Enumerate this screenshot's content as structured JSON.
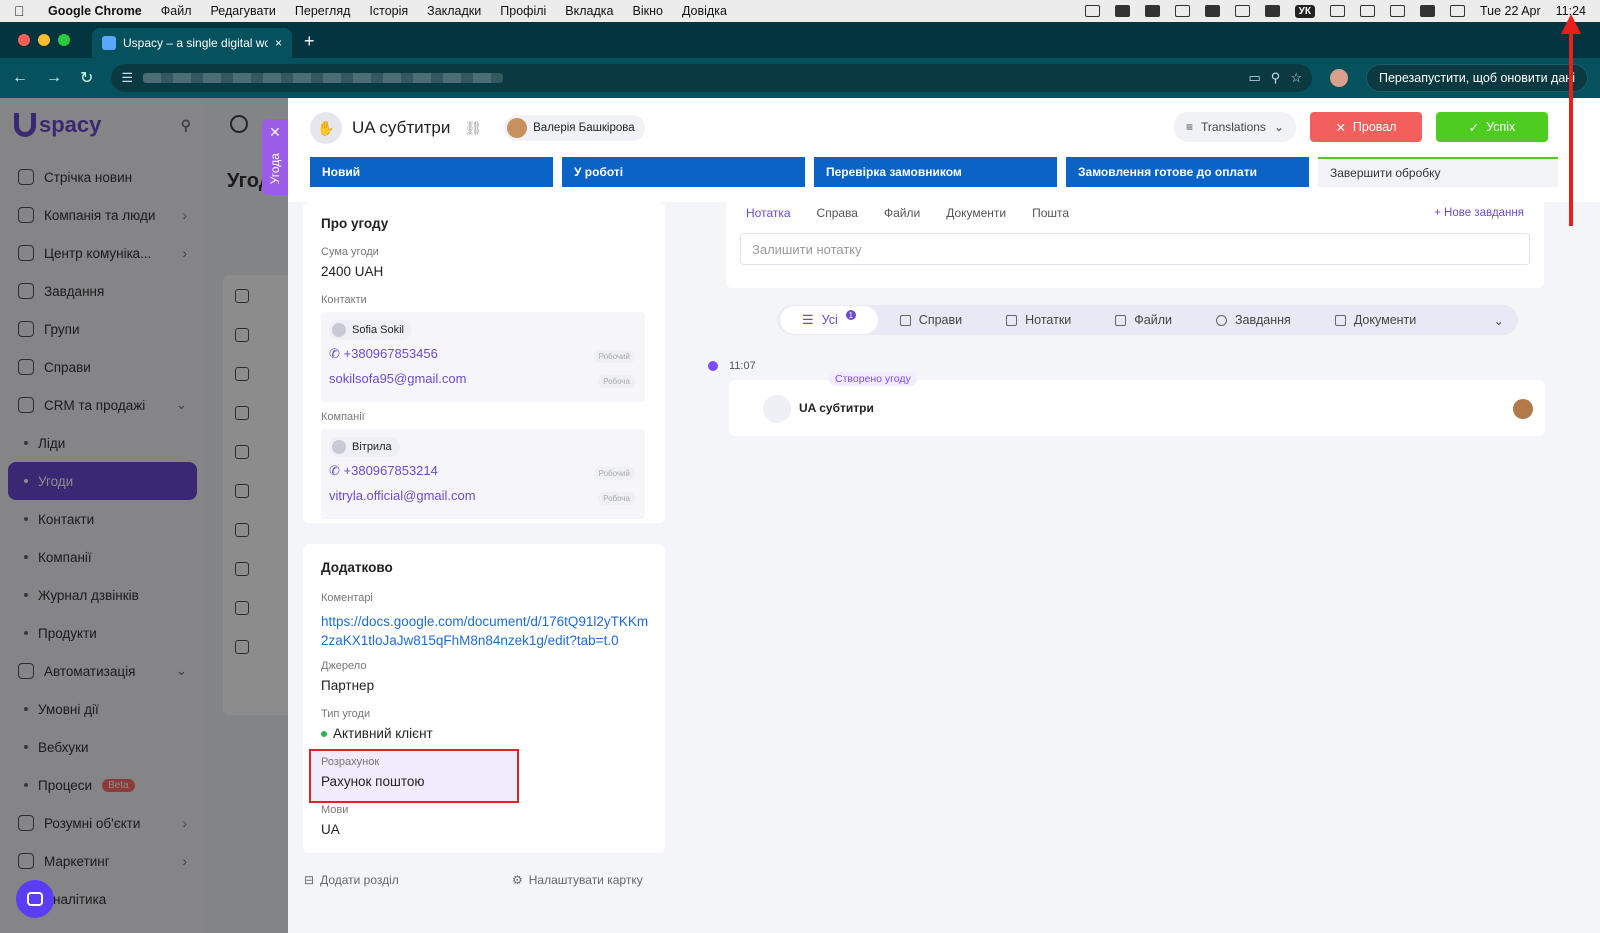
{
  "menubar": {
    "app": "Google Chrome",
    "items": [
      "Файл",
      "Редагувати",
      "Перегляд",
      "Історія",
      "Закладки",
      "Профілі",
      "Вкладка",
      "Вікно",
      "Довідка"
    ],
    "keyboard": "УК",
    "date": "Tue 22 Apr",
    "time": "11:24"
  },
  "browser": {
    "tab_title": "Uspacy – a single digital work",
    "relaunch_label": "Перезапустити, щоб оновити дані"
  },
  "sidebar": {
    "logo": "spacy",
    "items": [
      {
        "label": "Стрічка новин",
        "type": "main"
      },
      {
        "label": "Компанія та люди",
        "type": "main",
        "chevron": "›"
      },
      {
        "label": "Центр комунікa...",
        "type": "main",
        "chevron": "›"
      },
      {
        "label": "Завдання",
        "type": "main"
      },
      {
        "label": "Групи",
        "type": "main"
      },
      {
        "label": "Справи",
        "type": "main"
      },
      {
        "label": "CRM та продажі",
        "type": "main",
        "chevron": "⌄"
      },
      {
        "label": "Ліди",
        "type": "sub"
      },
      {
        "label": "Угоди",
        "type": "sub",
        "active": true
      },
      {
        "label": "Контакти",
        "type": "sub"
      },
      {
        "label": "Компанії",
        "type": "sub"
      },
      {
        "label": "Журнал дзвінків",
        "type": "sub"
      },
      {
        "label": "Продукти",
        "type": "sub"
      },
      {
        "label": "Автоматизація",
        "type": "main",
        "chevron": "⌄"
      },
      {
        "label": "Умовні дії",
        "type": "sub"
      },
      {
        "label": "Вебхуки",
        "type": "sub"
      },
      {
        "label": "Процеси",
        "type": "sub",
        "badge": "Beta"
      },
      {
        "label": "Розумні об'єкти",
        "type": "main",
        "chevron": "›"
      },
      {
        "label": "Маркетинг",
        "type": "main",
        "chevron": "›"
      },
      {
        "label": "Аналітика",
        "type": "main"
      }
    ]
  },
  "background": {
    "title": "Угод"
  },
  "deal_tab": {
    "label": "Угода"
  },
  "deal": {
    "title": "UA субтитри",
    "owner": "Валерія Башкірова",
    "pipeline_label": "Translations",
    "fail_label": "Провал",
    "success_label": "Успіх",
    "stages": [
      "Новий",
      "У роботі",
      "Перевірка замовником",
      "Замовлення готове до оплати",
      "Завершити обробку"
    ]
  },
  "about": {
    "heading": "Про угоду",
    "amount_label": "Сума угоди",
    "amount": "2400 UAH",
    "contacts_label": "Контакти",
    "contact": {
      "name": "Sofia Sokil",
      "phone": "+380967853456",
      "phone_tag": "Робочий",
      "email": "sokilsofa95@gmail.com",
      "email_tag": "Робоча"
    },
    "companies_label": "Компанії",
    "company": {
      "name": "Вітрила",
      "phone": "+380967853214",
      "phone_tag": "Робочий",
      "email": "vitryla.official@gmail.com",
      "email_tag": "Робоча"
    }
  },
  "extra": {
    "heading": "Додатково",
    "comments_label": "Коментарі",
    "comments": "https://docs.google.com/document/d/176tQ91l2yTKKm2zaKX1tloJaJw815qFhM8n84nzek1g/edit?tab=t.0",
    "source_label": "Джерело",
    "source": "Партнер",
    "type_label": "Тип угоди",
    "type": "Активний клієнт",
    "payment_label": "Розрахунок",
    "payment": "Рахунок поштою",
    "languages_label": "Мови",
    "languages": "UA"
  },
  "footer": {
    "add_section": "Додати розділ",
    "configure": "Налаштувати картку"
  },
  "activity": {
    "tabs": [
      "Нотатка",
      "Справа",
      "Файли",
      "Документи",
      "Пошта"
    ],
    "new_task": "Нове завдання",
    "note_placeholder": "Залишити нотатку"
  },
  "filters": {
    "items": [
      "Усі",
      "Справи",
      "Нотатки",
      "Файли",
      "Завдання",
      "Документи"
    ],
    "all_count": "1"
  },
  "timeline": {
    "time": "11:07",
    "caption": "Створено угоду",
    "title": "UA субтитри"
  }
}
